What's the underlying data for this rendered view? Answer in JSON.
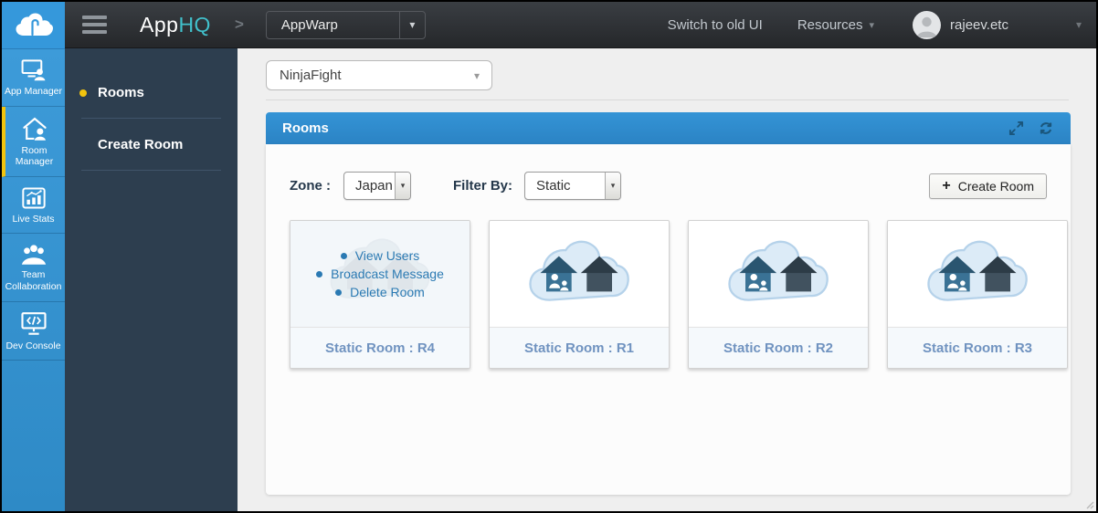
{
  "topbar": {
    "brand_part1": "App",
    "brand_part2": "HQ",
    "app_selector_value": "AppWarp",
    "switch_link": "Switch to old UI",
    "resources_link": "Resources",
    "username": "rajeev.etc"
  },
  "sidebar": {
    "active_item": "Room Manager",
    "items": [
      {
        "label": "App Manager",
        "icon": "app-manager-icon"
      },
      {
        "label": "Room Manager",
        "icon": "room-manager-icon"
      },
      {
        "label": "Live Stats",
        "icon": "live-stats-icon"
      },
      {
        "label": "Team Collaboration",
        "icon": "team-collaboration-icon"
      },
      {
        "label": "Dev Console",
        "icon": "dev-console-icon"
      }
    ]
  },
  "subsidebar": {
    "active_item": "Rooms",
    "items": [
      {
        "label": "Rooms"
      },
      {
        "label": "Create Room"
      }
    ]
  },
  "main": {
    "game_selector_value": "NinjaFight"
  },
  "panel": {
    "title": "Rooms",
    "zone_label": "Zone :",
    "zone_value": "Japan",
    "filter_label": "Filter By:",
    "filter_value": "Static",
    "create_button_label": "Create Room"
  },
  "rooms": [
    {
      "label": "Static Room : R4",
      "actions": [
        "View Users",
        "Broadcast Message",
        "Delete Room"
      ]
    },
    {
      "label": "Static Room : R1"
    },
    {
      "label": "Static Room : R2"
    },
    {
      "label": "Static Room : R3"
    }
  ],
  "icons": {
    "plus": "+",
    "caret_down": "▾",
    "breadcrumb_chevron": ">",
    "logo": "cloud-logo",
    "expand": "expand-arrows-icon",
    "refresh": "refresh-icon"
  },
  "colors": {
    "sidebar_blue": "#3391d0",
    "panel_header_blue": "#2f8dce",
    "active_yellow": "#f2c40e",
    "brand_teal": "#41c1cc",
    "menu_link_blue": "#2b7ab3",
    "room_label_blue": "#7093c0",
    "subsidebar_navy": "#2d3e4f",
    "topbar_dark": "#2b2e32"
  }
}
